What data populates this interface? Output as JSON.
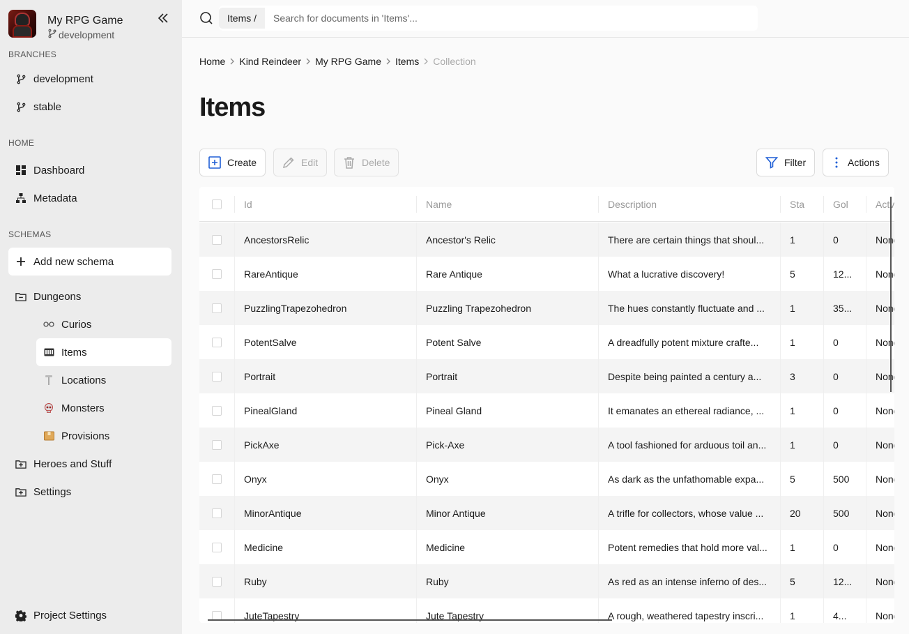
{
  "project": {
    "name": "My RPG Game",
    "branch": "development"
  },
  "sidebar": {
    "branches_label": "BRANCHES",
    "branches": [
      {
        "label": "development"
      },
      {
        "label": "stable"
      }
    ],
    "home_label": "HOME",
    "home_items": [
      {
        "label": "Dashboard",
        "icon": "dashboard-icon"
      },
      {
        "label": "Metadata",
        "icon": "sitemap-icon"
      }
    ],
    "schemas_label": "SCHEMAS",
    "add_schema": "Add new schema",
    "folders": [
      {
        "label": "Dungeons",
        "icon": "folder-open-icon"
      },
      {
        "label": "Heroes and Stuff",
        "icon": "folder-plus-icon"
      },
      {
        "label": "Settings",
        "icon": "folder-plus-icon"
      }
    ],
    "dungeon_items": [
      {
        "label": "Curios",
        "icon": "glasses-emoji-icon"
      },
      {
        "label": "Items",
        "icon": "abacus-emoji-icon"
      },
      {
        "label": "Locations",
        "icon": "pin-emoji-icon"
      },
      {
        "label": "Monsters",
        "icon": "skull-emoji-icon"
      },
      {
        "label": "Provisions",
        "icon": "package-emoji-icon"
      }
    ],
    "project_settings": "Project Settings"
  },
  "search": {
    "scope": "Items /",
    "placeholder": "Search for documents in 'Items'..."
  },
  "breadcrumb": [
    "Home",
    "Kind Reindeer",
    "My RPG Game",
    "Items",
    "Collection"
  ],
  "page_title": "Items",
  "toolbar": {
    "create": "Create",
    "edit": "Edit",
    "delete": "Delete",
    "filter": "Filter",
    "actions": "Actions"
  },
  "table": {
    "columns": [
      "Id",
      "Name",
      "Description",
      "Sta",
      "Gol",
      "Actv"
    ],
    "rows": [
      {
        "id": "AncestorsRelic",
        "name": "Ancestor's Relic",
        "description": "There are certain things that shoul...",
        "stack": "1",
        "gold": "0",
        "active": "None"
      },
      {
        "id": "RareAntique",
        "name": "Rare Antique",
        "description": "What a lucrative discovery!",
        "stack": "5",
        "gold": "12...",
        "active": "None"
      },
      {
        "id": "PuzzlingTrapezohedron",
        "name": "Puzzling Trapezohedron",
        "description": "The hues constantly fluctuate and ...",
        "stack": "1",
        "gold": "35...",
        "active": "None"
      },
      {
        "id": "PotentSalve",
        "name": "Potent Salve",
        "description": "A dreadfully potent mixture crafte...",
        "stack": "1",
        "gold": "0",
        "active": "None"
      },
      {
        "id": "Portrait",
        "name": "Portrait",
        "description": "Despite being painted a century a...",
        "stack": "3",
        "gold": "0",
        "active": "None"
      },
      {
        "id": "PinealGland",
        "name": "Pineal Gland",
        "description": "It emanates an ethereal radiance, ...",
        "stack": "1",
        "gold": "0",
        "active": "None"
      },
      {
        "id": "PickAxe",
        "name": "Pick-Axe",
        "description": "A tool fashioned for arduous toil an...",
        "stack": "1",
        "gold": "0",
        "active": "None"
      },
      {
        "id": "Onyx",
        "name": "Onyx",
        "description": "As dark as the unfathomable expa...",
        "stack": "5",
        "gold": "500",
        "active": "None"
      },
      {
        "id": "MinorAntique",
        "name": "Minor Antique",
        "description": "A trifle for collectors, whose value ...",
        "stack": "20",
        "gold": "500",
        "active": "None"
      },
      {
        "id": "Medicine",
        "name": "Medicine",
        "description": "Potent remedies that hold more val...",
        "stack": "1",
        "gold": "0",
        "active": "None"
      },
      {
        "id": "Ruby",
        "name": "Ruby",
        "description": "As red as an intense inferno of des...",
        "stack": "5",
        "gold": "12...",
        "active": "None"
      },
      {
        "id": "JuteTapestry",
        "name": "Jute Tapestry",
        "description": "A rough, weathered tapestry inscri...",
        "stack": "1",
        "gold": "4...",
        "active": "None"
      }
    ]
  },
  "colors": {
    "accent": "#1f5fd6",
    "sidebar_bg": "#ececec",
    "page_bg": "#fafafa"
  }
}
